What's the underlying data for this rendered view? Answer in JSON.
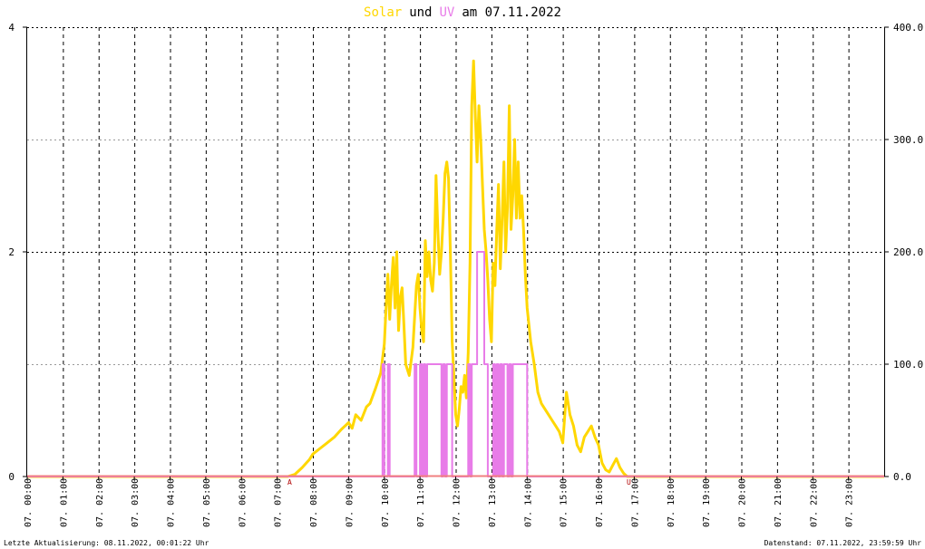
{
  "chart_data": {
    "type": "line",
    "title": {
      "solar_word": "Solar",
      "und": "und",
      "uv_word": "UV",
      "date_part": "am 07.11.2022"
    },
    "colors": {
      "solar": "#FFD700",
      "uv": "#E87CE8",
      "baseline": "#F08080",
      "grid": "#000000",
      "marker": "#b00000"
    },
    "left_axis": {
      "ylim": [
        0,
        4
      ],
      "ticks": [
        "0",
        "2",
        "4"
      ]
    },
    "right_axis": {
      "ylim": [
        0,
        400
      ],
      "ticks": [
        "0.0",
        "100.0",
        "200.0",
        "300.0",
        "400.0"
      ]
    },
    "xlim_hours": [
      0,
      24
    ],
    "x_ticks": [
      "07. 00:00",
      "07. 01:00",
      "07. 02:00",
      "07. 03:00",
      "07. 04:00",
      "07. 05:00",
      "07. 06:00",
      "07. 07:00",
      "07. 08:00",
      "07. 09:00",
      "07. 10:00",
      "07. 11:00",
      "07. 12:00",
      "07. 13:00",
      "07. 14:00",
      "07. 15:00",
      "07. 16:00",
      "07. 17:00",
      "07. 18:00",
      "07. 19:00",
      "07. 20:00",
      "07. 21:00",
      "07. 22:00",
      "07. 23:00"
    ],
    "markers": [
      {
        "label": "A",
        "hour": 7.35
      },
      {
        "label": "U",
        "hour": 16.85
      }
    ],
    "series": [
      {
        "name": "Solar",
        "axis": "right",
        "x_hours": [
          0,
          7.3,
          7.5,
          7.7,
          7.9,
          8.0,
          8.2,
          8.4,
          8.6,
          8.8,
          9.0,
          9.1,
          9.2,
          9.35,
          9.5,
          9.6,
          9.75,
          9.9,
          10.0,
          10.05,
          10.1,
          10.15,
          10.2,
          10.25,
          10.3,
          10.35,
          10.4,
          10.45,
          10.5,
          10.55,
          10.6,
          10.7,
          10.8,
          10.9,
          10.95,
          11.0,
          11.05,
          11.1,
          11.15,
          11.2,
          11.25,
          11.3,
          11.35,
          11.4,
          11.45,
          11.5,
          11.55,
          11.6,
          11.65,
          11.7,
          11.75,
          11.8,
          11.85,
          11.9,
          11.95,
          12.0,
          12.05,
          12.1,
          12.15,
          12.2,
          12.25,
          12.3,
          12.35,
          12.4,
          12.45,
          12.5,
          12.55,
          12.6,
          12.65,
          12.7,
          12.75,
          12.8,
          12.85,
          12.9,
          12.95,
          13.0,
          13.05,
          13.1,
          13.15,
          13.2,
          13.25,
          13.3,
          13.35,
          13.4,
          13.45,
          13.5,
          13.55,
          13.6,
          13.65,
          13.7,
          13.75,
          13.8,
          13.85,
          13.9,
          13.95,
          14.0,
          14.1,
          14.2,
          14.3,
          14.4,
          14.5,
          14.6,
          14.7,
          14.8,
          14.9,
          15.0,
          15.1,
          15.2,
          15.3,
          15.4,
          15.5,
          15.6,
          15.7,
          15.8,
          15.9,
          16.0,
          16.1,
          16.2,
          16.3,
          16.4,
          16.5,
          16.6,
          16.7,
          16.8,
          24
        ],
        "values": [
          0,
          0,
          2,
          8,
          15,
          20,
          25,
          30,
          35,
          42,
          48,
          43,
          55,
          50,
          62,
          65,
          78,
          92,
          118,
          150,
          180,
          140,
          170,
          195,
          150,
          200,
          130,
          160,
          168,
          135,
          100,
          90,
          115,
          170,
          180,
          150,
          130,
          120,
          210,
          178,
          200,
          175,
          165,
          190,
          268,
          220,
          180,
          200,
          230,
          270,
          280,
          265,
          200,
          120,
          90,
          55,
          45,
          60,
          80,
          75,
          90,
          70,
          110,
          190,
          330,
          370,
          320,
          280,
          330,
          300,
          260,
          220,
          200,
          175,
          140,
          120,
          190,
          170,
          220,
          260,
          185,
          230,
          280,
          200,
          240,
          330,
          220,
          250,
          300,
          230,
          280,
          230,
          250,
          220,
          180,
          150,
          120,
          100,
          75,
          65,
          60,
          55,
          50,
          45,
          40,
          30,
          75,
          55,
          45,
          28,
          22,
          35,
          40,
          45,
          35,
          28,
          12,
          6,
          4,
          10,
          16,
          8,
          3,
          0,
          0
        ]
      },
      {
        "name": "UV",
        "axis": "left",
        "x_hours": [
          0,
          9.95,
          9.95,
          10.0,
          10.0,
          10.1,
          10.1,
          10.15,
          10.15,
          10.85,
          10.85,
          10.9,
          10.9,
          11.0,
          11.0,
          11.05,
          11.05,
          11.1,
          11.1,
          11.15,
          11.15,
          11.2,
          11.2,
          11.25,
          11.25,
          11.6,
          11.6,
          11.65,
          11.65,
          11.7,
          11.7,
          11.75,
          11.75,
          11.85,
          11.85,
          11.9,
          11.9,
          11.95,
          11.95,
          12.35,
          12.35,
          12.4,
          12.4,
          12.45,
          12.45,
          12.55,
          12.55,
          12.6,
          12.6,
          12.8,
          12.8,
          12.9,
          12.9,
          13.05,
          13.05,
          13.1,
          13.1,
          13.15,
          13.15,
          13.2,
          13.2,
          13.25,
          13.25,
          13.3,
          13.3,
          13.35,
          13.35,
          13.45,
          13.45,
          13.5,
          13.5,
          13.55,
          13.55,
          13.6,
          13.6,
          14.0,
          14.0,
          24
        ],
        "values": [
          0,
          0,
          1,
          1,
          0,
          0,
          1,
          1,
          0,
          0,
          1,
          1,
          0,
          0,
          1,
          1,
          0,
          0,
          1,
          1,
          0,
          0,
          1,
          1,
          1,
          1,
          0,
          0,
          1,
          1,
          0,
          0,
          1,
          1,
          1,
          1,
          0,
          0,
          0,
          0,
          1,
          1,
          0,
          0,
          1,
          1,
          1,
          1,
          2,
          2,
          1,
          1,
          0,
          0,
          1,
          1,
          0,
          0,
          1,
          1,
          0,
          0,
          1,
          1,
          0,
          0,
          1,
          1,
          0,
          0,
          1,
          1,
          0,
          0,
          1,
          1,
          0,
          0
        ]
      }
    ]
  },
  "footer": {
    "left": "Letzte Aktualisierung: 08.11.2022, 00:01:22 Uhr",
    "right": "Datenstand: 07.11.2022, 23:59:59 Uhr"
  }
}
